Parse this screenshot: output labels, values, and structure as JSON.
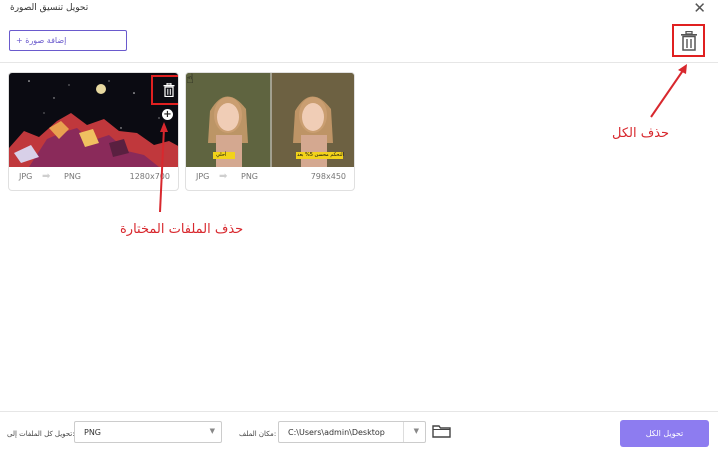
{
  "window": {
    "title": "تحويل تنسيق الصورة"
  },
  "toolbar": {
    "add_label": "+ إضافة صورة"
  },
  "files": [
    {
      "src_format": "JPG",
      "dst_format": "PNG",
      "dims": "1280x700"
    },
    {
      "src_format": "JPG",
      "dst_format": "PNG",
      "dims": "798x450",
      "caption_left": "أحلي",
      "caption_right": "التحكم محسن 5% بعد"
    }
  ],
  "annotations": {
    "delete_all": "حذف الكل",
    "delete_selected": "حذف الملفات المختارة"
  },
  "footer": {
    "convert_all_to_label": "تحويل كل الملفات إلى:",
    "format_value": "PNG",
    "location_label": "مكان الملف:",
    "location_value": "C:\\Users\\admin\\Desktop",
    "convert_label": "تحويل الكل"
  },
  "colors": {
    "accent": "#8d7cf0",
    "highlight": "#e02020"
  }
}
